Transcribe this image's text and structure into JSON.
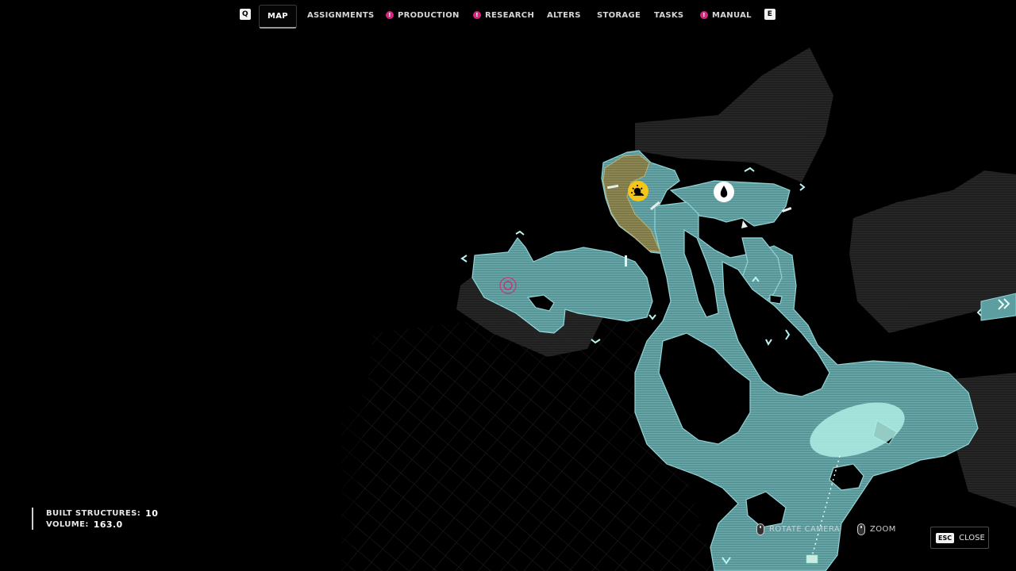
{
  "nav": {
    "prev_key": "Q",
    "next_key": "E",
    "tabs": [
      {
        "label": "MAP",
        "active": true,
        "alert": false
      },
      {
        "label": "ASSIGNMENTS",
        "active": false,
        "alert": false
      },
      {
        "label": "PRODUCTION",
        "active": false,
        "alert": true
      },
      {
        "label": "RESEARCH",
        "active": false,
        "alert": true
      },
      {
        "label": "ALTERS",
        "active": false,
        "alert": false
      },
      {
        "label": "STORAGE",
        "active": false,
        "alert": false
      },
      {
        "label": "TASKS",
        "active": false,
        "alert": false
      },
      {
        "label": "MANUAL",
        "active": false,
        "alert": true
      }
    ],
    "alert_glyph": "!"
  },
  "stats": {
    "built_label": "BUILT STRUCTURES:",
    "built_value": "10",
    "volume_label": "VOLUME:",
    "volume_value": "163.0"
  },
  "controls": {
    "rotate_label": "ROTATE CAMERA",
    "zoom_label": "ZOOM",
    "close_key": "ESC",
    "close_label": "CLOSE"
  },
  "map": {
    "markers": [
      {
        "name": "yellow-resource-marker",
        "icon": "sun-icon",
        "color": "#f5c518"
      },
      {
        "name": "water-marker",
        "icon": "droplet-icon",
        "color": "#ffffff"
      },
      {
        "name": "pink-marker",
        "icon": "target-icon",
        "color": "#c2357a"
      }
    ],
    "colors": {
      "cave": "#5d9ea0",
      "cave_edge": "#8fd4d6",
      "highlight_zone": "#8a8452",
      "terrain": "#3a3a3a",
      "selection": "#b7f0e8",
      "accent": "#d6257f"
    }
  }
}
